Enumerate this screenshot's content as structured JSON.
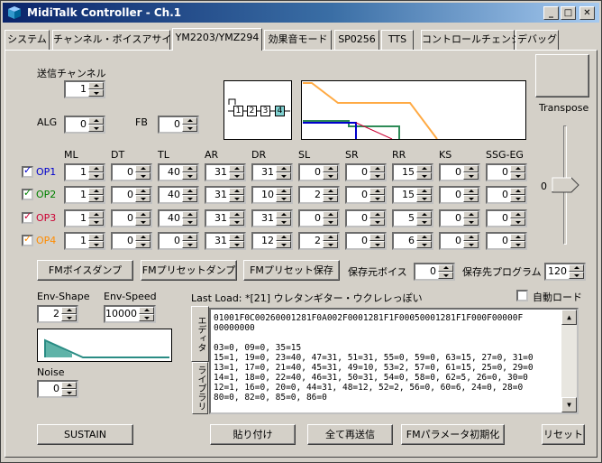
{
  "window": {
    "title": "MidiTalk Controller - Ch.1"
  },
  "tabs": [
    "システム",
    "チャンネル・ボイスアサイン",
    "YM2203/YMZ294",
    "効果音モード",
    "SP0256",
    "TTS",
    "コントロールチェンジ",
    "デバッグ"
  ],
  "params": {
    "send_channel_label": "送信チャンネル",
    "send_channel": "1",
    "alg_label": "ALG",
    "alg": "0",
    "fb_label": "FB",
    "fb": "0",
    "alg_ops": [
      "1",
      "2",
      "3",
      "4"
    ],
    "transpose_label": "Transpose",
    "transpose_value": "0"
  },
  "op_headers": [
    "ML",
    "DT",
    "TL",
    "AR",
    "DR",
    "SL",
    "SR",
    "RR",
    "KS",
    "SSG-EG"
  ],
  "ops": [
    {
      "label": "OP1",
      "color": "#0000cc",
      "checked": true,
      "values": [
        "1",
        "0",
        "40",
        "31",
        "31",
        "0",
        "0",
        "15",
        "0",
        "0"
      ]
    },
    {
      "label": "OP2",
      "color": "#008000",
      "checked": true,
      "values": [
        "1",
        "0",
        "40",
        "31",
        "10",
        "2",
        "0",
        "15",
        "0",
        "0"
      ]
    },
    {
      "label": "OP3",
      "color": "#cc0033",
      "checked": true,
      "values": [
        "1",
        "0",
        "40",
        "31",
        "31",
        "0",
        "0",
        "5",
        "0",
        "0"
      ]
    },
    {
      "label": "OP4",
      "color": "#ff8c00",
      "checked": true,
      "values": [
        "1",
        "0",
        "0",
        "31",
        "12",
        "2",
        "0",
        "6",
        "0",
        "0"
      ]
    }
  ],
  "buttons": {
    "voice_dump": "FMボイスダンプ",
    "preset_dump": "FMプリセットダンプ",
    "preset_save": "FMプリセット保存",
    "sustain": "SUSTAIN",
    "paste": "貼り付け",
    "resend": "全て再送信",
    "fm_init": "FMパラメータ初期化",
    "reset": "リセット"
  },
  "save_source_label": "保存元ボイス",
  "save_source": "0",
  "save_dest_label": "保存先プログラム",
  "save_dest": "120",
  "env": {
    "shape_label": "Env-Shape",
    "shape": "2",
    "speed_label": "Env-Speed",
    "speed": "10000",
    "noise_label": "Noise",
    "noise": "0"
  },
  "last_load": "Last Load: *[21] ウレタンギター・ウクレレっぽい",
  "auto_load_label": "自動ロード",
  "side_tabs": [
    "エディタ",
    "ライブラリ"
  ],
  "memo_lines": [
    "01001F0C00260001281F0A002F0001281F1F00050001281F1F000F00000F",
    "00000000",
    "",
    "03=0, 09=0, 35=15",
    "15=1, 19=0, 23=40, 47=31, 51=31, 55=0, 59=0, 63=15, 27=0, 31=0",
    "13=1, 17=0, 21=40, 45=31, 49=10, 53=2, 57=0, 61=15, 25=0, 29=0",
    "14=1, 18=0, 22=40, 46=31, 50=31, 54=0, 58=0, 62=5, 26=0, 30=0",
    "12=1, 16=0, 20=0, 44=31, 48=12, 52=2, 56=0, 60=6, 24=0, 28=0",
    "80=0, 82=0, 85=0, 86=0"
  ],
  "colors": {
    "titlebar": "#0a246a",
    "env_fill": "#5fb3a8",
    "env_line": "#2a8c84"
  }
}
